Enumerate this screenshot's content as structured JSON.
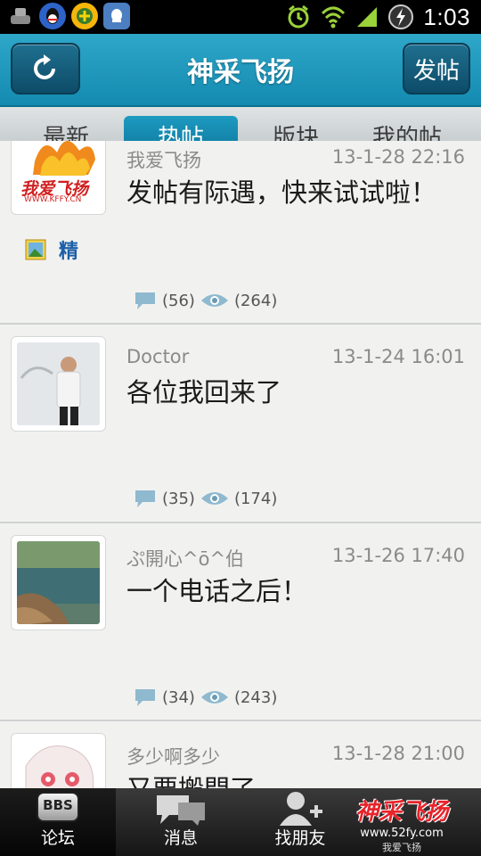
{
  "status_bar": {
    "time": "1:03"
  },
  "header": {
    "title": "神采飞扬",
    "post_button": "发帖"
  },
  "tabs": [
    {
      "label": "最新"
    },
    {
      "label": "热帖"
    },
    {
      "label": "版块"
    },
    {
      "label": "我的帖"
    }
  ],
  "posts": [
    {
      "author": "我爱飞扬",
      "time": "13-1-28 22:16",
      "title": "发帖有际遇，快来试试啦！",
      "replies": "(56)",
      "views": "(264)",
      "badge_featured": "精",
      "avatar_text": "我爱飞扬",
      "avatar_url": "WWW.KFFY.CN"
    },
    {
      "author": "Doctor",
      "time": "13-1-24 16:01",
      "title": "各位我回来了",
      "replies": "(35)",
      "views": "(174)"
    },
    {
      "author": "ぷ開心^ō^伯",
      "time": "13-1-26 17:40",
      "title": "一个电话之后！",
      "replies": "(34)",
      "views": "(243)"
    },
    {
      "author": "多少啊多少",
      "time": "13-1-28 21:00",
      "title": "又要搬門了"
    }
  ],
  "bottom_nav": [
    {
      "label": "论坛",
      "badge": "BBS"
    },
    {
      "label": "消息"
    },
    {
      "label": "找朋友"
    }
  ],
  "watermark": {
    "logo": "神采飞扬",
    "url": "www.52fy.com",
    "sub": "我爱飞扬"
  }
}
